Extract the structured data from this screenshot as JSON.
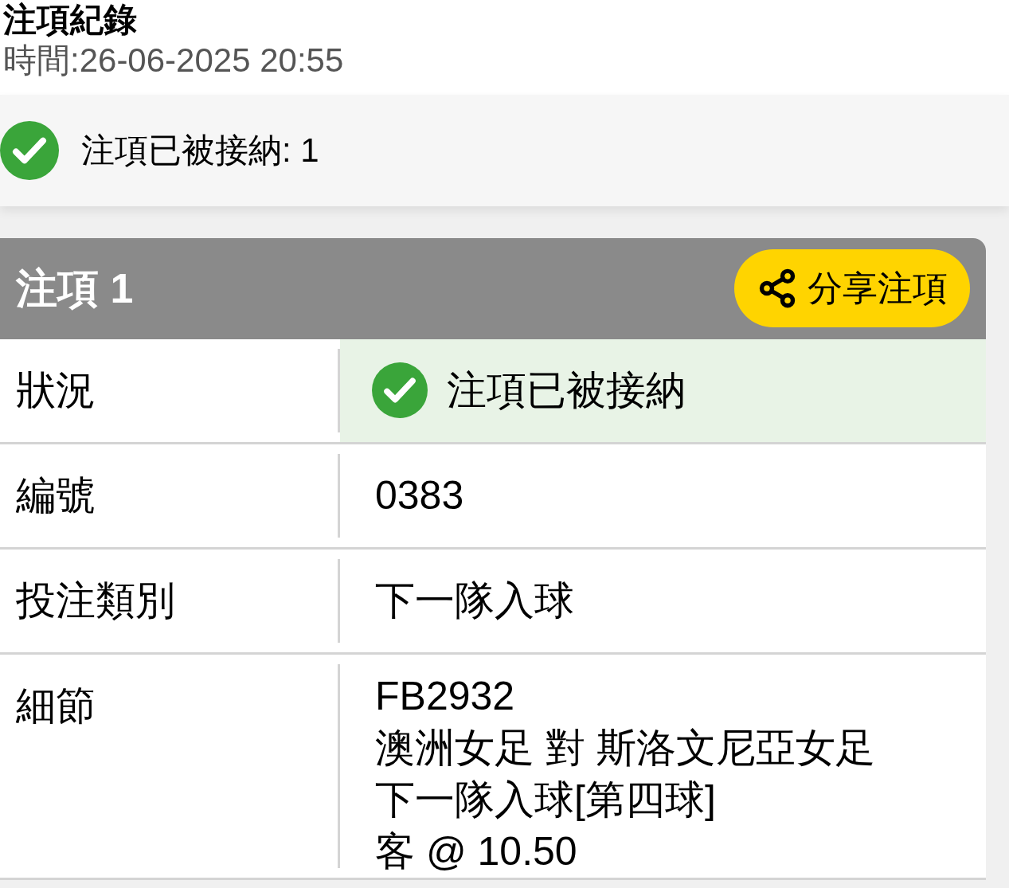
{
  "page": {
    "title": "注項紀錄",
    "time": "時間:26-06-2025 20:55"
  },
  "summary": {
    "accepted": true,
    "text": "注項已被接納: 1"
  },
  "bet": {
    "title": "注項 1",
    "share_button": "分享注項",
    "rows": [
      {
        "kind": "status",
        "label": "狀況",
        "accepted": true,
        "value": "注項已被接納"
      },
      {
        "kind": "text",
        "label": "編號",
        "value": "0383"
      },
      {
        "kind": "text",
        "label": "投注類別",
        "value": "下一隊入球"
      },
      {
        "kind": "lines",
        "label": "細節",
        "lines": [
          "FB2932",
          "澳洲女足 對 斯洛文尼亞女足",
          "下一隊入球[第四球]",
          "客 @ 10.50"
        ]
      }
    ]
  }
}
